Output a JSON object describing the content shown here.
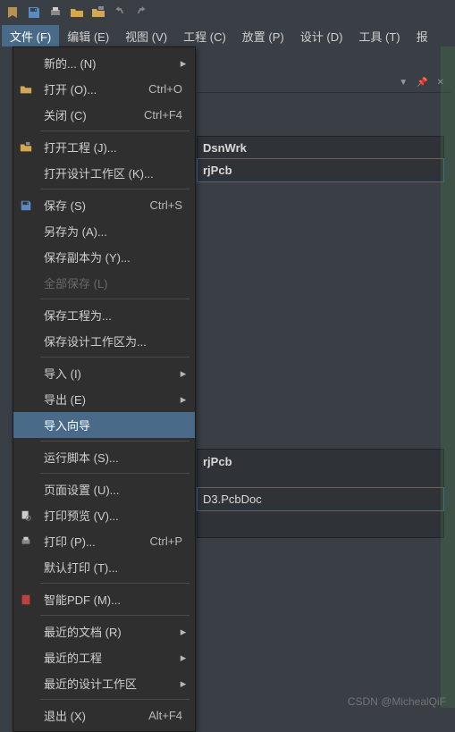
{
  "toolbar_icons": [
    "logo",
    "save",
    "print-setup",
    "open-folder",
    "open-project",
    "undo",
    "redo"
  ],
  "menubar": [
    {
      "label": "文件 (F)",
      "active": true
    },
    {
      "label": "编辑 (E)"
    },
    {
      "label": "视图 (V)"
    },
    {
      "label": "工程 (C)"
    },
    {
      "label": "放置 (P)"
    },
    {
      "label": "设计 (D)"
    },
    {
      "label": "工具 (T)"
    },
    {
      "label": "报"
    }
  ],
  "menu": {
    "new": "新的... (N)",
    "open": "打开 (O)...",
    "open_sc": "Ctrl+O",
    "close": "关闭 (C)",
    "close_sc": "Ctrl+F4",
    "open_project": "打开工程 (J)...",
    "open_workspace": "打开设计工作区 (K)...",
    "save": "保存 (S)",
    "save_sc": "Ctrl+S",
    "save_as": "另存为 (A)...",
    "save_copy": "保存副本为 (Y)...",
    "save_all": "全部保存 (L)",
    "save_project": "保存工程为...",
    "save_workspace": "保存设计工作区为...",
    "import": "导入 (I)",
    "export": "导出 (E)",
    "import_wizard": "导入向导",
    "run_script": "运行脚本 (S)...",
    "page_setup": "页面设置 (U)...",
    "print_preview": "打印预览 (V)...",
    "print": "打印 (P)...",
    "print_sc": "Ctrl+P",
    "default_print": "默认打印 (T)...",
    "smart_pdf": "智能PDF (M)...",
    "recent_docs": "最近的文档 (R)",
    "recent_projects": "最近的工程",
    "recent_workspaces": "最近的设计工作区",
    "exit": "退出 (X)",
    "exit_sc": "Alt+F4"
  },
  "panel": {
    "row1": "DsnWrk",
    "row2": "rjPcb",
    "row3": "rjPcb",
    "row4": "D3.PcbDoc"
  },
  "watermark": "CSDN @MichealQiF"
}
